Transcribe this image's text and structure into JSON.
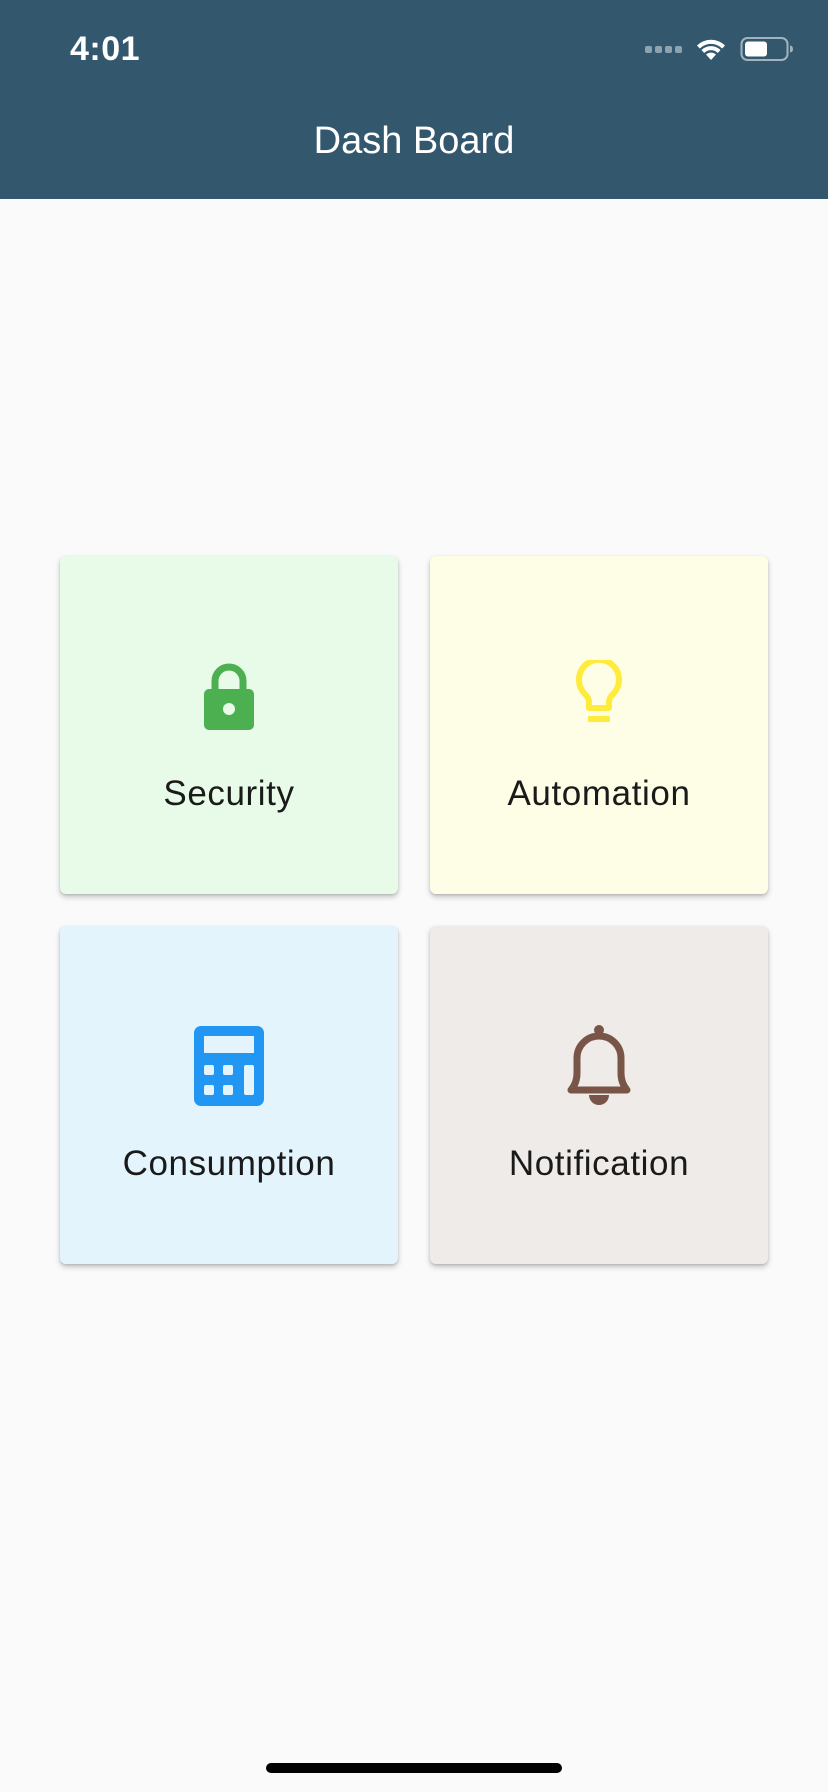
{
  "status_bar": {
    "time": "4:01"
  },
  "header": {
    "title": "Dash Board",
    "background": "#33586e"
  },
  "tiles": [
    {
      "label": "Security",
      "icon": "lock-icon",
      "background": "#e8fbe8",
      "icon_color": "#4caf50"
    },
    {
      "label": "Automation",
      "icon": "lightbulb-icon",
      "background": "#fefee6",
      "icon_color": "#ffeb3b"
    },
    {
      "label": "Consumption",
      "icon": "calculator-icon",
      "background": "#e4f4fd",
      "icon_color": "#2196f3"
    },
    {
      "label": "Notification",
      "icon": "bell-icon",
      "background": "#efebe8",
      "icon_color": "#795548"
    }
  ]
}
